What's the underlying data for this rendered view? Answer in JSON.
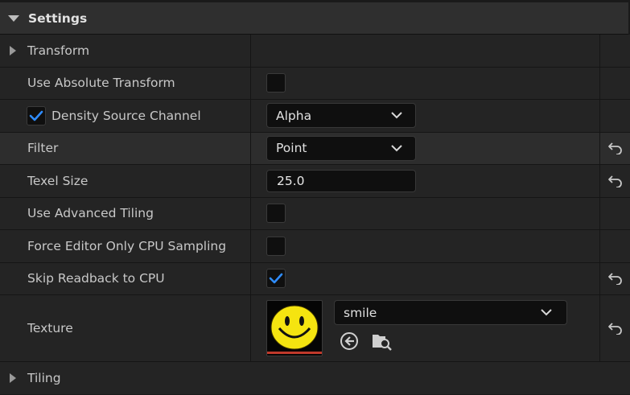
{
  "section": {
    "title": "Settings"
  },
  "properties": {
    "transform": {
      "label": "Transform"
    },
    "use_absolute_transform": {
      "label": "Use Absolute Transform",
      "checked": false
    },
    "density_source_channel": {
      "label": "Density Source Channel",
      "enabled": true,
      "value": "Alpha"
    },
    "filter": {
      "label": "Filter",
      "value": "Point"
    },
    "texel_size": {
      "label": "Texel Size",
      "value": "25.0"
    },
    "use_advanced_tiling": {
      "label": "Use Advanced Tiling",
      "checked": false
    },
    "force_editor_only_cpu_sampling": {
      "label": "Force Editor Only CPU Sampling",
      "checked": false
    },
    "skip_readback_to_cpu": {
      "label": "Skip Readback to CPU",
      "checked": true
    },
    "texture": {
      "label": "Texture",
      "value": "smile"
    },
    "tiling": {
      "label": "Tiling"
    }
  },
  "icons": {
    "reset": "reset-arrow-icon",
    "use_selected": "arrow-left-circle-icon",
    "browse": "folder-search-icon",
    "dropdown": "chevron-down-icon"
  },
  "colors": {
    "accent_check": "#2f8cff",
    "texture_bar": "#c0392b"
  }
}
